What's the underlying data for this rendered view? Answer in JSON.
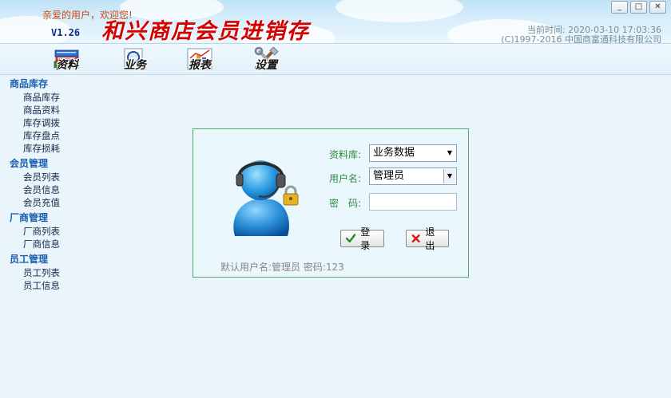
{
  "header": {
    "welcome": "亲爱的用户，欢迎您!",
    "version": "V1.26",
    "app_title": "和兴商店会员进销存",
    "time_label": "当前时间:",
    "time_value": "2020-03-10 17:03:36",
    "copyright": "(C)1997-2016 中国商富通科技有限公司"
  },
  "window_controls": {
    "minimize": "_",
    "restore": "□",
    "close": "✕"
  },
  "toolbar": [
    {
      "label": "资料",
      "icon": "books-icon"
    },
    {
      "label": "业务",
      "icon": "magnifier-icon"
    },
    {
      "label": "报表",
      "icon": "report-chart-icon"
    },
    {
      "label": "设置",
      "icon": "tools-icon"
    }
  ],
  "sidebar": {
    "groups": [
      {
        "title": "商品库存",
        "items": [
          "商品库存",
          "商品资料",
          "库存调拨",
          "库存盘点",
          "库存损耗"
        ]
      },
      {
        "title": "会员管理",
        "items": [
          "会员列表",
          "会员信息",
          "会员充值"
        ]
      },
      {
        "title": "厂商管理",
        "items": [
          "厂商列表",
          "厂商信息"
        ]
      },
      {
        "title": "员工管理",
        "items": [
          "员工列表",
          "员工信息"
        ]
      }
    ]
  },
  "login": {
    "db_label": "资料库:",
    "db_value": "业务数据",
    "user_label": "用户名:",
    "user_value": "管理员",
    "pwd_label": "密　码:",
    "pwd_value": "",
    "login_button": "登录",
    "exit_button": "退出",
    "hint": "默认用户名:管理员 密码:123",
    "avatar_icon": "user-headset-icon",
    "lock_icon": "lock-icon"
  },
  "colors": {
    "title_red": "#d40000",
    "welcome_orange": "#d14a14",
    "version_blue": "#0f2f8c",
    "sidebar_head_blue": "#1b5fb0",
    "login_label_green": "#2c8a3a",
    "panel_border_green": "#54a86a",
    "page_bg": "#e9f4fb"
  }
}
